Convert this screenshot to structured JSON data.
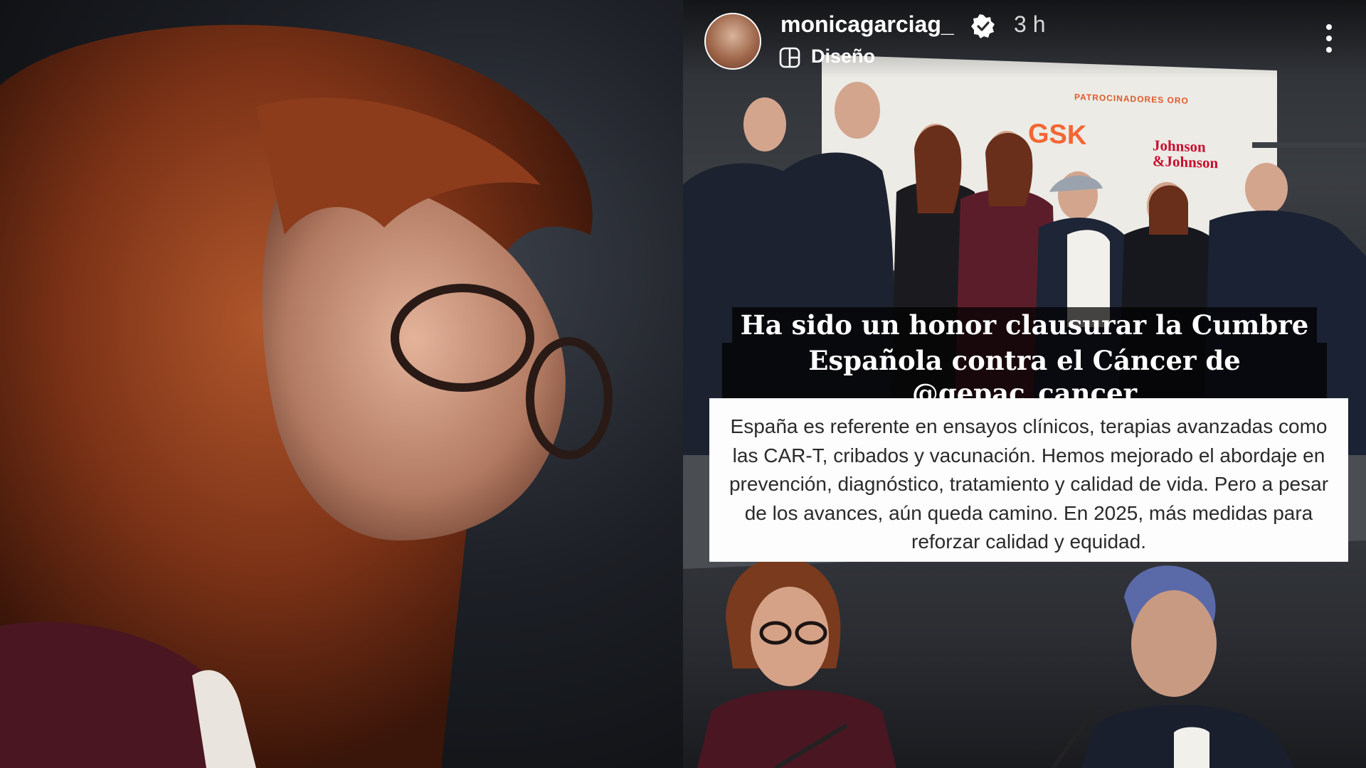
{
  "story": {
    "username": "monicagarciag_",
    "time": "3 h",
    "layout_label": "Diseño",
    "caption_line1": "Ha sido un honor clausurar la Cumbre",
    "caption_line2_prefix": "Española contra el Cáncer de ",
    "caption_mention": "@gepac_cancer",
    "quote": "España es referente en ensayos clínicos, terapias avanzadas como las CAR-T, cribados y vacunación. Hemos mejorado el abordaje en prevención, diagnóstico, tratamiento y calidad de vida. Pero a pesar de los avances, aún queda camino. En 2025, más medidas para reforzar calidad y equidad."
  },
  "banner": {
    "sponsor_heading": "PATROCINADORES ORO",
    "logo_gsk": "GSK",
    "logo_jj": "Johnson &Johnson"
  },
  "icons": {
    "verified": "verified-badge-icon",
    "layout": "layout-icon",
    "more": "more-options-icon"
  },
  "colors": {
    "banner_accent": "#e0592b",
    "jj_red": "#c8102e",
    "gsk_orange": "#f36633"
  }
}
